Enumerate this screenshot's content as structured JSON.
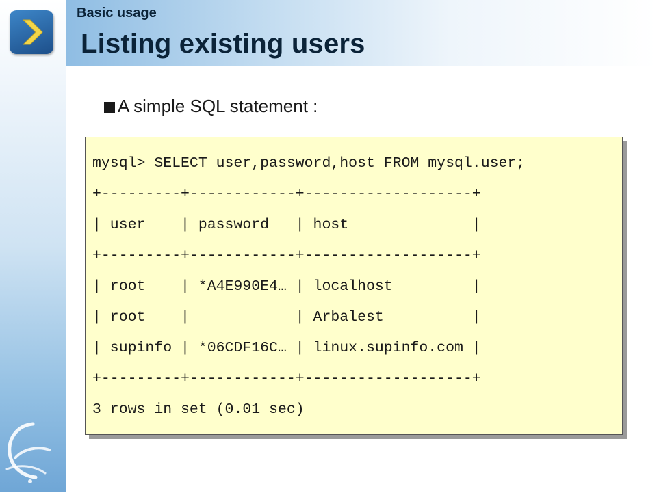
{
  "header": {
    "section_label": "Basic usage",
    "title": "Listing existing users",
    "nav_icon": "chevron-right-icon"
  },
  "body": {
    "bullet": "A simple SQL statement :"
  },
  "code": {
    "lines": [
      "mysql> SELECT user,password,host FROM mysql.user;",
      "+---------+------------+-------------------+",
      "| user    | password   | host              |",
      "+---------+------------+-------------------+",
      "| root    | *A4E990E4… | localhost         |",
      "| root    |            | Arbalest          |",
      "| supinfo | *06CDF16C… | linux.supinfo.com |",
      "+---------+------------+-------------------+",
      "3 rows in set (0.01 sec)"
    ]
  },
  "colors": {
    "code_background": "#ffffcc",
    "title_color": "#0b2338",
    "accent_blue": "#1d4f8a"
  },
  "branding": {
    "logo_icon": "swoosh-logo-icon"
  }
}
